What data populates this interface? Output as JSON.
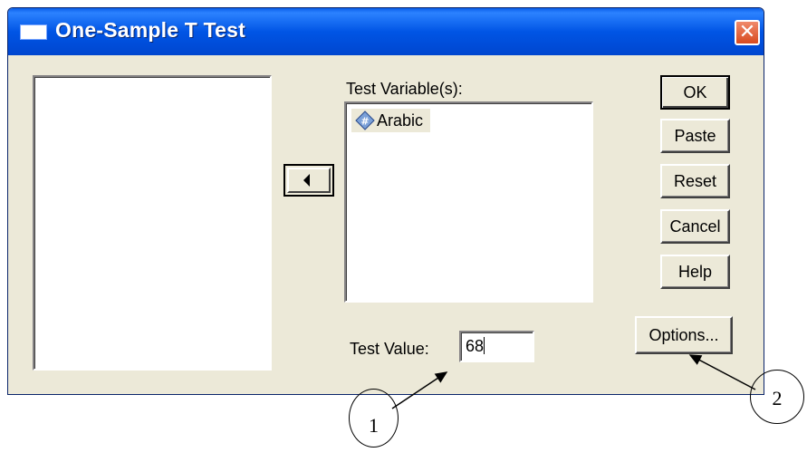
{
  "window": {
    "title": "One-Sample T Test",
    "close_symbol": "✕"
  },
  "source_list": {
    "items": []
  },
  "target": {
    "label": "Test Variable(s):",
    "items": [
      {
        "name": "Arabic",
        "icon": "scale-variable-icon"
      }
    ]
  },
  "move_button": {
    "icon": "arrow-left-icon"
  },
  "buttons": {
    "ok": "OK",
    "paste": "Paste",
    "reset": "Reset",
    "cancel": "Cancel",
    "help": "Help",
    "options": "Options..."
  },
  "test_value": {
    "label": "Test Value:",
    "value": "68"
  },
  "annotations": [
    {
      "number": "1"
    },
    {
      "number": "2"
    }
  ],
  "colors": {
    "titlebar": "#0055e5",
    "dialog_bg": "#ece9d8",
    "close_button": "#d84a1f"
  }
}
